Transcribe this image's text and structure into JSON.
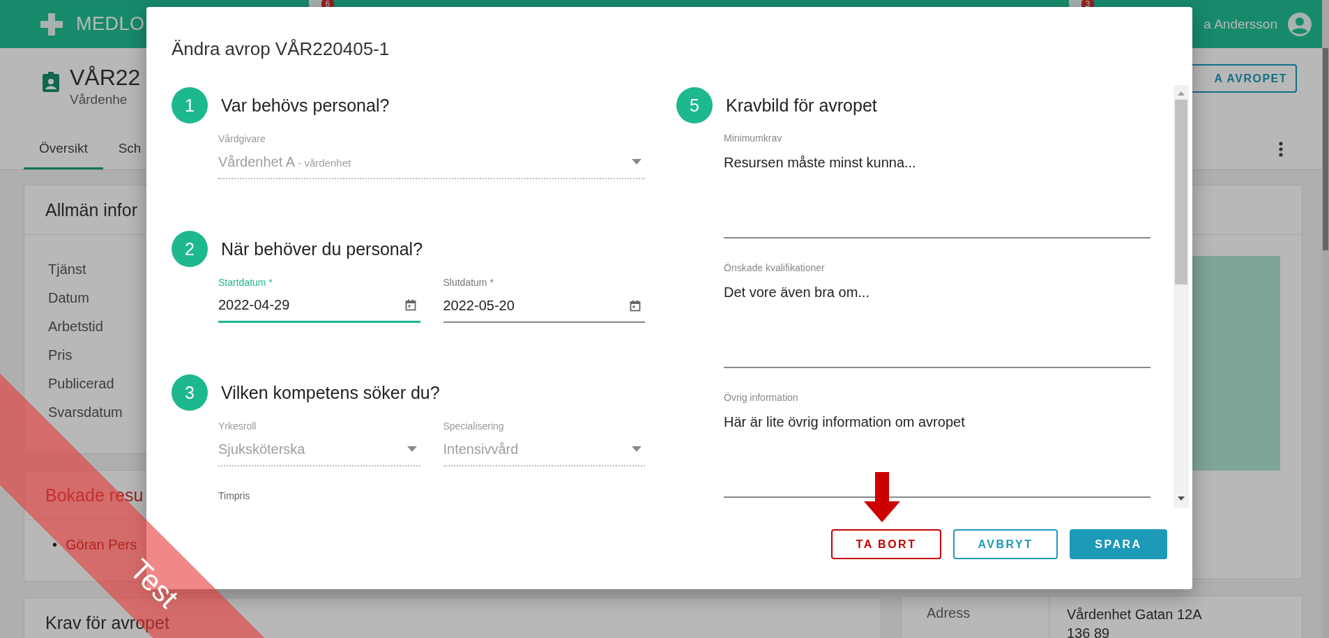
{
  "topbar": {
    "brand": "MEDLO",
    "badges": [
      "6",
      "3"
    ],
    "user": "a Andersson"
  },
  "header": {
    "title": "VÅR22",
    "subtitle": "Vårdenhe",
    "action": "A AVROPET"
  },
  "tabs": [
    {
      "label": "Översikt",
      "selected": true
    },
    {
      "label": "Sch",
      "selected": false
    }
  ],
  "general_card": {
    "title": "Allmän infor",
    "rows": [
      "Tjänst",
      "Datum",
      "Arbetstid",
      "Pris",
      "Publicerad",
      "Svarsdatum"
    ]
  },
  "booked_card": {
    "title": "Bokade resu",
    "bullet": "•",
    "items": [
      "Göran Pers"
    ]
  },
  "requirements_card": {
    "title": "Krav för avropet"
  },
  "address": {
    "label": "Adress",
    "lines": [
      "Vårdenhet Gatan 12A",
      "136 89"
    ]
  },
  "dialog": {
    "title": "Ändra avrop VÅR220405-1",
    "left_sections": [
      {
        "number": "1",
        "heading": "Var behövs personal?",
        "fields": [
          {
            "kind": "select",
            "label": "Vårdgivare",
            "value": "Vårdenhet A",
            "detail": "- vårdenhet",
            "wide": true,
            "disabled": true
          }
        ]
      },
      {
        "number": "2",
        "heading": "När behöver du personal?",
        "fields": [
          {
            "kind": "date",
            "label": "Startdatum *",
            "value": "2022-04-29",
            "focused": true
          },
          {
            "kind": "date",
            "label": "Slutdatum *",
            "value": "2022-05-20",
            "focused": false
          }
        ]
      },
      {
        "number": "3",
        "heading": "Vilken kompetens söker du?",
        "fields": [
          {
            "kind": "select",
            "label": "Yrkesroll",
            "value": "Sjuksköterska",
            "disabled": true
          },
          {
            "kind": "select",
            "label": "Specialisering",
            "value": "Intensivvård",
            "disabled": true
          },
          {
            "kind": "label",
            "label": "Timpris"
          }
        ]
      }
    ],
    "right_section": {
      "number": "5",
      "heading": "Kravbild för avropet",
      "fields": [
        {
          "label": "Minimumkrav",
          "value": "Resursen måste minst kunna..."
        },
        {
          "label": "Önskade kvalifikationer",
          "value": "Det vore även bra om..."
        },
        {
          "label": "Övrig information",
          "value": "Här är lite övrig information om avropet"
        }
      ]
    },
    "buttons": [
      {
        "kind": "danger",
        "label": "TA BORT",
        "pointed": true
      },
      {
        "kind": "outline",
        "label": "AVBRYT",
        "pointed": false
      },
      {
        "kind": "primary",
        "label": "SPARA",
        "pointed": false
      }
    ]
  },
  "ribbon": {
    "label": "Test"
  }
}
